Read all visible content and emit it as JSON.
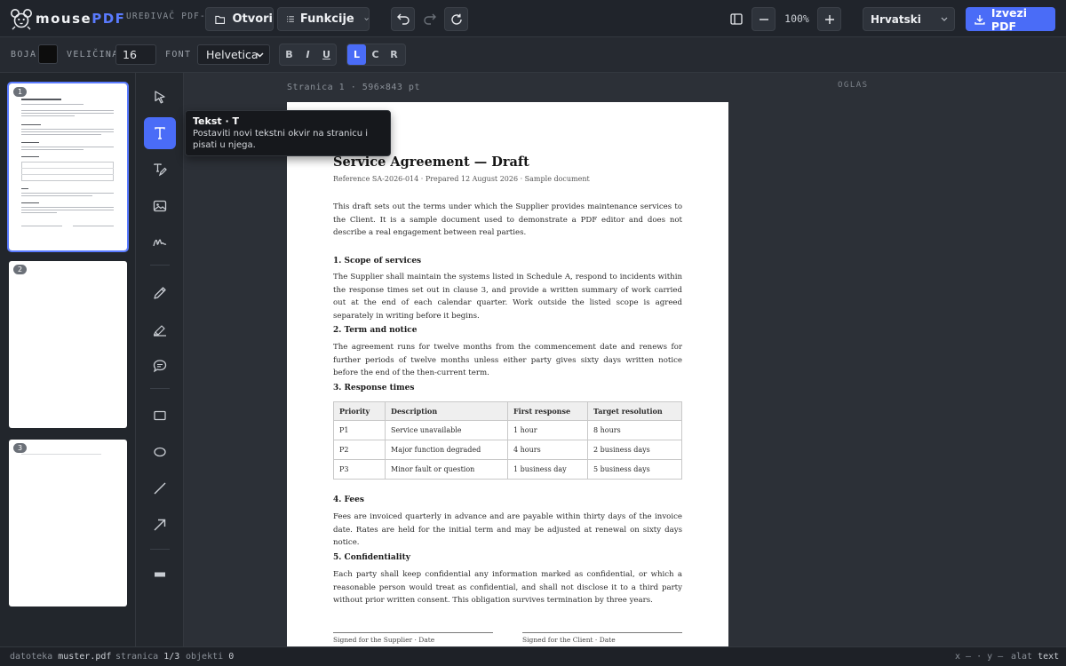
{
  "app": {
    "brand_name": "mouse",
    "brand_suffix": "PDF",
    "brand_tagline": "UREĐIVAČ PDF-a"
  },
  "toolbar": {
    "open_label": "Otvori",
    "functions_label": "Funkcije",
    "zoom_level": "100%",
    "language": "Hrvatski",
    "export_label": "Izvezi PDF"
  },
  "format": {
    "color_label": "BOJA",
    "color_value": "#0d0d0d",
    "size_label": "VELIČINA",
    "size_value": "16",
    "font_label": "FONT",
    "font_value": "Helvetica",
    "bold": "B",
    "italic": "I",
    "underline": "U",
    "align_left": "L",
    "align_center": "C",
    "align_right": "R"
  },
  "thumbnails": [
    {
      "number": "1",
      "selected": true
    },
    {
      "number": "2",
      "selected": false
    },
    {
      "number": "3",
      "selected": false
    }
  ],
  "tools": [
    {
      "name": "select-tool",
      "icon": "cursor-icon"
    },
    {
      "name": "text-tool",
      "icon": "text-icon",
      "active": true
    },
    {
      "name": "text-edit-tool",
      "icon": "text-edit-icon"
    },
    {
      "name": "image-tool",
      "icon": "image-icon"
    },
    {
      "name": "signature-tool",
      "icon": "signature-icon"
    },
    {
      "name": "pen-tool",
      "icon": "pencil-icon"
    },
    {
      "name": "highlight-tool",
      "icon": "highlighter-icon"
    },
    {
      "name": "comment-tool",
      "icon": "comment-icon"
    },
    {
      "name": "rectangle-tool",
      "icon": "rectangle-icon"
    },
    {
      "name": "ellipse-tool",
      "icon": "ellipse-icon"
    },
    {
      "name": "line-tool",
      "icon": "line-icon"
    },
    {
      "name": "arrow-tool",
      "icon": "arrow-icon"
    },
    {
      "name": "redact-tool",
      "icon": "redact-icon"
    }
  ],
  "tooltip": {
    "title": "Tekst · T",
    "description": "Postaviti novi tekstni okvir na stranicu i pisati u njega."
  },
  "canvas": {
    "page_meta": "Stranica 1 · 596×843 pt",
    "ad_label": "OGLAS"
  },
  "document": {
    "title": "Service Agreement — Draft",
    "subtitle": "Reference SA-2026-014 · Prepared 12 August 2026 · Sample document",
    "intro": "This draft sets out the terms under which the Supplier provides maintenance services to the Client. It is a sample document used to demonstrate a PDF editor and does not describe a real engagement between real parties.",
    "sections": [
      {
        "heading": "1. Scope of services",
        "body": "The Supplier shall maintain the systems listed in Schedule A, respond to incidents within the response times set out in clause 3, and provide a written summary of work carried out at the end of each calendar quarter. Work outside the listed scope is agreed separately in writing before it begins."
      },
      {
        "heading": "2. Term and notice",
        "body": "The agreement runs for twelve months from the commencement date and renews for further periods of twelve months unless either party gives sixty days written notice before the end of the then-current term."
      },
      {
        "heading": "3. Response times",
        "body": ""
      },
      {
        "heading": "4. Fees",
        "body": "Fees are invoiced quarterly in advance and are payable within thirty days of the invoice date. Rates are held for the initial term and may be adjusted at renewal on sixty days notice."
      },
      {
        "heading": "5. Confidentiality",
        "body": "Each party shall keep confidential any information marked as confidential, or which a reasonable person would treat as confidential, and shall not disclose it to a third party without prior written consent. This obligation survives termination by three years."
      }
    ],
    "table": {
      "headers": [
        "Priority",
        "Description",
        "First response",
        "Target resolution"
      ],
      "rows": [
        [
          "P1",
          "Service unavailable",
          "1 hour",
          "8 hours"
        ],
        [
          "P2",
          "Major function degraded",
          "4 hours",
          "2 business days"
        ],
        [
          "P3",
          "Minor fault or question",
          "1 business day",
          "5 business days"
        ]
      ]
    },
    "signature_supplier": "Signed for the Supplier · Date",
    "signature_client": "Signed for the Client · Date"
  },
  "status": {
    "file_label": "datoteka",
    "file_value": "muster.pdf",
    "page_label": "stranica",
    "page_value": "1/3",
    "objects_label": "objekti",
    "objects_value": "0",
    "coords": "x — · y —",
    "tool_label": "alat",
    "tool_value": "text"
  }
}
